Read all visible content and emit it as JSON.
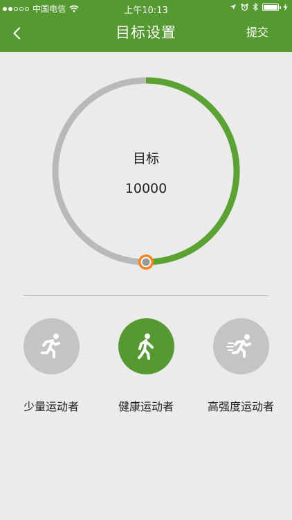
{
  "status_bar": {
    "carrier": "中国电信",
    "time": "上午10:13"
  },
  "nav": {
    "title": "目标设置",
    "submit_label": "提交"
  },
  "goal": {
    "label": "目标",
    "value": "10000",
    "progress_fraction": 0.5
  },
  "levels": [
    {
      "label": "少量运动者",
      "icon": "running-person-icon",
      "active": false
    },
    {
      "label": "健康运动者",
      "icon": "walking-person-icon",
      "active": true
    },
    {
      "label": "高强度运动者",
      "icon": "sprinting-person-icon",
      "active": false
    }
  ],
  "colors": {
    "accent": "#559a31",
    "track": "#b9b9b9",
    "knob": "#f5821f",
    "inactive_circle": "#c4c4c4",
    "background": "#ebebeb"
  }
}
